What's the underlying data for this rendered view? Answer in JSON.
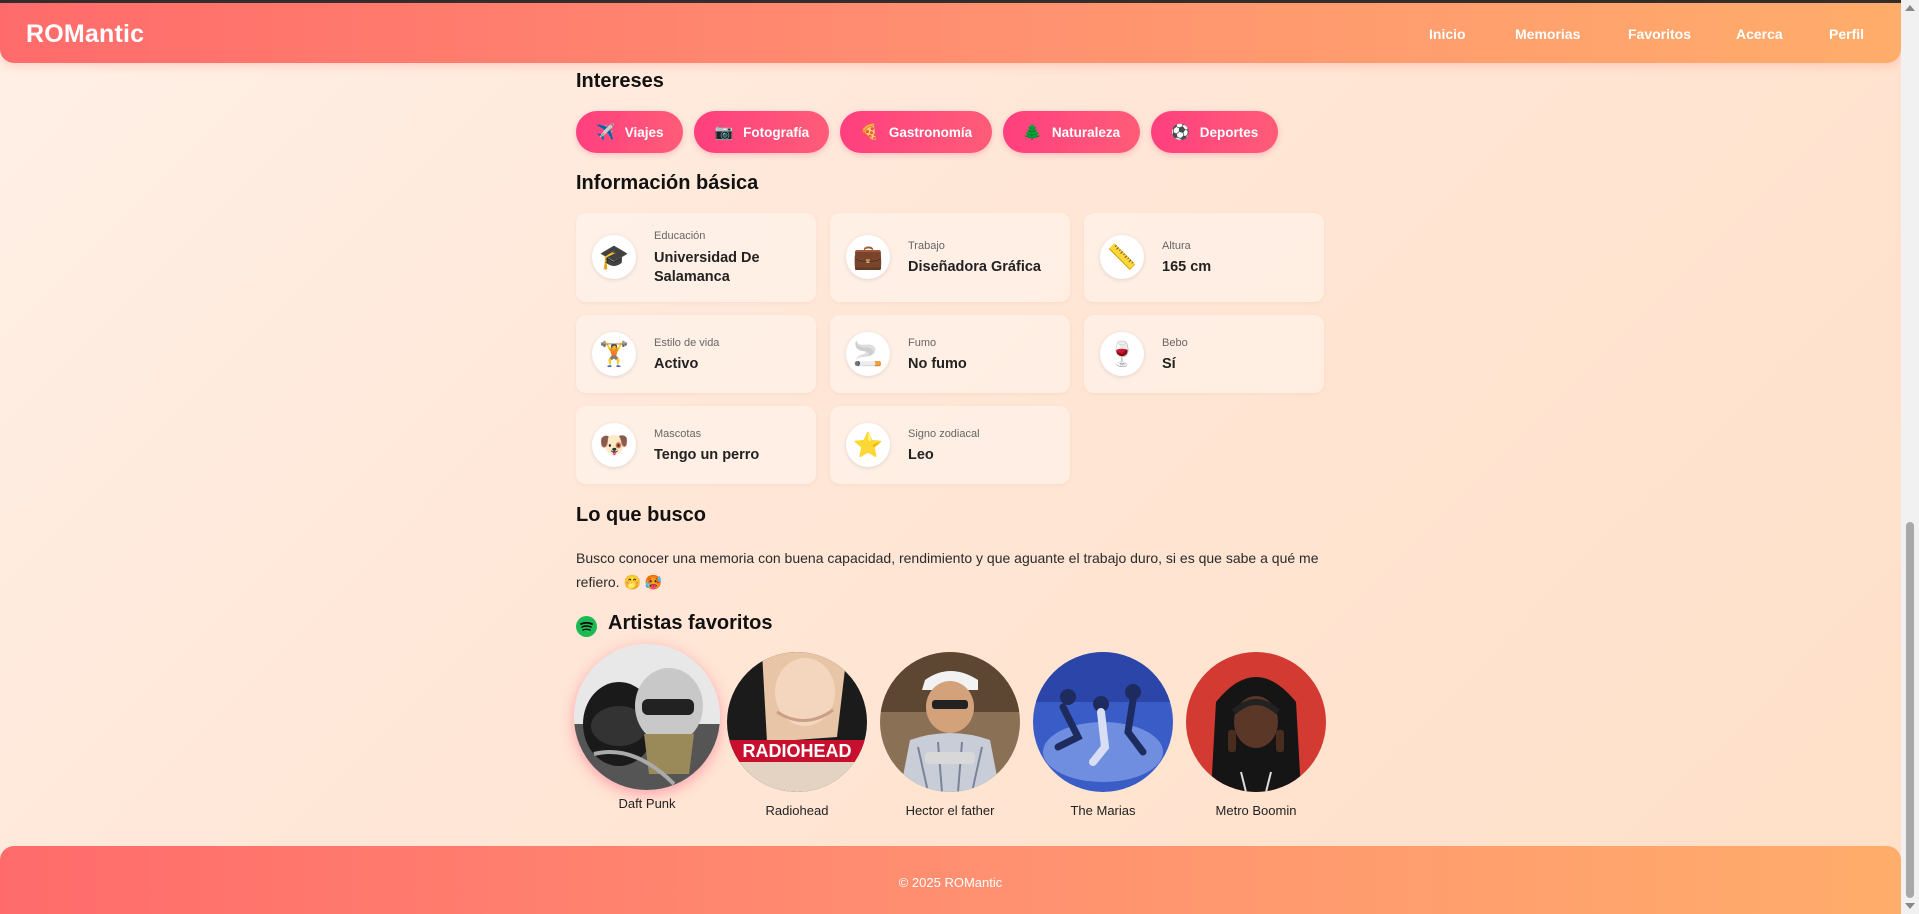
{
  "header": {
    "logo": "ROMantic",
    "nav": [
      "Inicio",
      "Memorias",
      "Favoritos",
      "Acerca",
      "Perfil"
    ]
  },
  "interests": {
    "title": "Intereses",
    "items": [
      {
        "icon": "airplane-icon",
        "glyph": "✈️",
        "label": "Viajes"
      },
      {
        "icon": "camera-icon",
        "glyph": "📷",
        "label": "Fotografía"
      },
      {
        "icon": "pizza-icon",
        "glyph": "🍕",
        "label": "Gastronomía"
      },
      {
        "icon": "tree-icon",
        "glyph": "🌲",
        "label": "Naturaleza"
      },
      {
        "icon": "soccer-ball-icon",
        "glyph": "⚽",
        "label": "Deportes"
      }
    ]
  },
  "basic_info": {
    "title": "Información básica",
    "items": [
      {
        "icon": "graduation-cap-icon",
        "glyph": "🎓",
        "label": "Educación",
        "value": "Universidad De Salamanca"
      },
      {
        "icon": "briefcase-icon",
        "glyph": "💼",
        "label": "Trabajo",
        "value": "Diseñadora Gráfica"
      },
      {
        "icon": "ruler-icon",
        "glyph": "📏",
        "label": "Altura",
        "value": "165 cm"
      },
      {
        "icon": "weightlifter-icon",
        "glyph": "🏋️",
        "label": "Estilo de vida",
        "value": "Activo"
      },
      {
        "icon": "cigarette-icon",
        "glyph": "🚬",
        "label": "Fumo",
        "value": "No fumo"
      },
      {
        "icon": "wine-glass-icon",
        "glyph": "🍷",
        "label": "Bebo",
        "value": "Sí"
      },
      {
        "icon": "dog-icon",
        "glyph": "🐶",
        "label": "Mascotas",
        "value": "Tengo un perro"
      },
      {
        "icon": "star-icon",
        "glyph": "⭐",
        "label": "Signo zodiacal",
        "value": "Leo"
      }
    ]
  },
  "looking_for": {
    "title": "Lo que busco",
    "text_line1": "Busco conocer una memoria con buena capacidad, rendimiento y que aguante el trabajo duro, si es que sabe a qué me",
    "text_line2": "refiero. 🤭 🥵"
  },
  "artists": {
    "title": "Artistas favoritos",
    "items": [
      "Daft Punk",
      "Radiohead",
      "Hector el father",
      "The Marias",
      "Metro Boomin"
    ],
    "radiohead_logo_text": "RADIOHEAD"
  },
  "footer": {
    "text": "© 2025 ROMantic"
  },
  "colors": {
    "header_gradient_start": "#ff6b6b",
    "header_gradient_end": "#ffad6b",
    "chip": "#ff4b7a",
    "spotify": "#1db954"
  }
}
